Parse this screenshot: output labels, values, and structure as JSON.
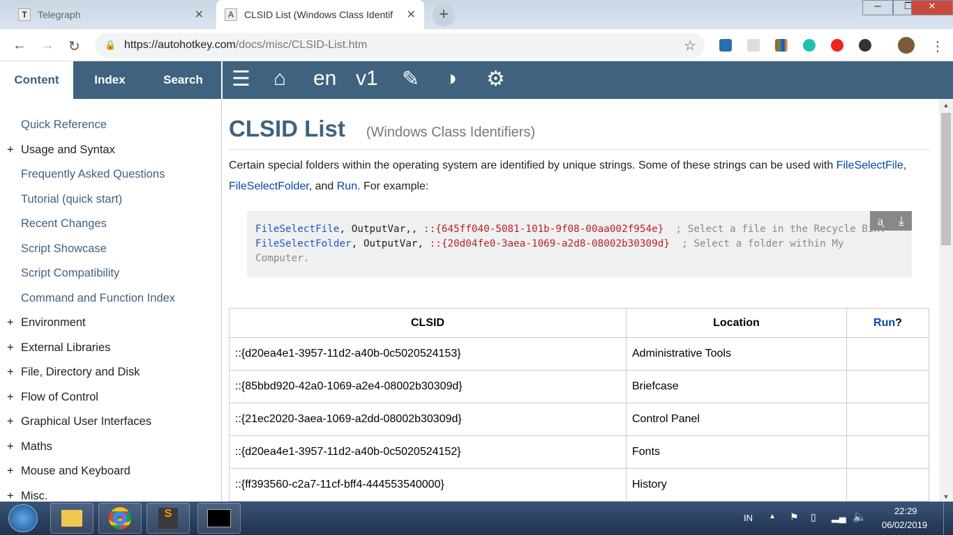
{
  "browser": {
    "tabs": [
      {
        "label": "Telegraph",
        "favicon": "T"
      },
      {
        "label": "CLSID List (Windows Class Identif",
        "favicon": "A"
      }
    ],
    "new_tab": "+",
    "url_host": "https://autohotkey.com",
    "url_path": "/docs/misc/CLSID-List.htm"
  },
  "sidebar": {
    "tabs": [
      "Content",
      "Index",
      "Search"
    ],
    "items": [
      {
        "label": "Quick Reference",
        "expandable": false
      },
      {
        "label": "Usage and Syntax",
        "expandable": true
      },
      {
        "label": "Frequently Asked Questions",
        "expandable": false
      },
      {
        "label": "Tutorial (quick start)",
        "expandable": false
      },
      {
        "label": "Recent Changes",
        "expandable": false
      },
      {
        "label": "Script Showcase",
        "expandable": false
      },
      {
        "label": "Script Compatibility",
        "expandable": false
      },
      {
        "label": "Command and Function Index",
        "expandable": false
      },
      {
        "label": "Environment",
        "expandable": true
      },
      {
        "label": "External Libraries",
        "expandable": true
      },
      {
        "label": "File, Directory and Disk",
        "expandable": true
      },
      {
        "label": "Flow of Control",
        "expandable": true
      },
      {
        "label": "Graphical User Interfaces",
        "expandable": true
      },
      {
        "label": "Maths",
        "expandable": true
      },
      {
        "label": "Mouse and Keyboard",
        "expandable": true
      },
      {
        "label": "Misc.",
        "expandable": true
      }
    ]
  },
  "toolbar": {
    "lang": "en",
    "version": "v1"
  },
  "page": {
    "title": "CLSID List",
    "subtitle": "(Windows Class Identifiers)",
    "intro_1": "Certain special folders within the operating system are identified by unique strings. Some of these strings can be used with ",
    "link1": "FileSelectFile",
    "sep1": ", ",
    "link2": "FileSelectFolder",
    "sep2": ", and ",
    "link3": "Run",
    "intro_2": ". For example:",
    "code": [
      {
        "cmd": "FileSelectFile",
        "args": ", OutputVar,, ",
        "clsid": "::{645ff040-5081-101b-9f08-00aa002f954e}",
        "comment": "  ; Select a file in the Recycle Bin."
      },
      {
        "cmd": "FileSelectFolder",
        "args": ", OutputVar, ",
        "clsid": "::{20d04fe0-3aea-1069-a2d8-08002b30309d}",
        "comment": "  ; Select a folder within My Computer."
      }
    ],
    "table": {
      "headers": [
        "CLSID",
        "Location",
        "Run",
        "?"
      ],
      "rows": [
        [
          "::{d20ea4e1-3957-11d2-a40b-0c5020524153}",
          "Administrative Tools",
          ""
        ],
        [
          "::{85bbd920-42a0-1069-a2e4-08002b30309d}",
          "Briefcase",
          ""
        ],
        [
          "::{21ec2020-3aea-1069-a2dd-08002b30309d}",
          "Control Panel",
          ""
        ],
        [
          "::{d20ea4e1-3957-11d2-a40b-0c5020524152}",
          "Fonts",
          ""
        ],
        [
          "::{ff393560-c2a7-11cf-bff4-444553540000}",
          "History",
          ""
        ]
      ]
    }
  },
  "taskbar": {
    "lang": "IN",
    "time": "22:29",
    "date": "06/02/2019"
  }
}
